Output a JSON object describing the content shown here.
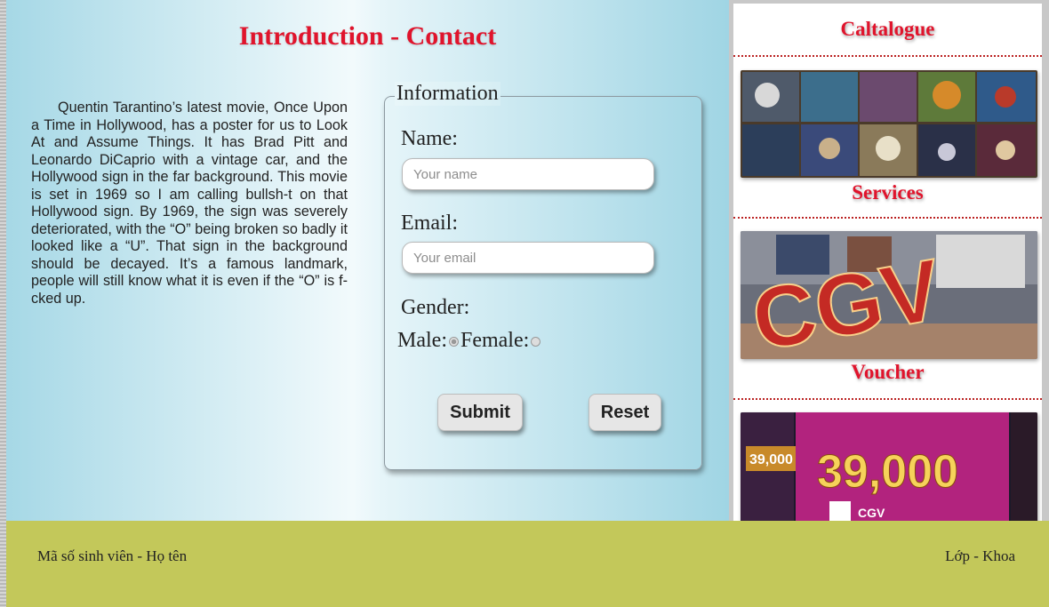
{
  "main": {
    "title": "Introduction - Contact",
    "intro_text": "Quentin Tarantino’s latest movie, Once Upon a Time in Hollywood, has a poster for us to Look At and Assume Things. It has Brad Pitt and Leonardo DiCaprio with a vintage car, and the Hollywood sign in the far background. This movie is set in 1969 so I am calling bullsh-t on that Hollywood sign. By 1969, the sign was severely deteriorated, with the “O” being broken so badly it looked like a “U”. That sign in the background should be decayed. It’s a famous landmark, people will still know what it is even if the “O” is f-cked up."
  },
  "form": {
    "legend": "Information",
    "name_label": "Name:",
    "name_placeholder": "Your name",
    "email_label": "Email:",
    "email_placeholder": "Your email",
    "gender_label": "Gender:",
    "male_label": "Male:",
    "female_label": "Female:",
    "submit_label": "Submit",
    "reset_label": "Reset"
  },
  "sidebar": {
    "catalogue_title": "Caltalogue",
    "services_title": "Services",
    "voucher_title": "Voucher",
    "cgv_sign_text": "CGV",
    "voucher_price_small": "39,000",
    "voucher_price_big": "39,000",
    "voucher_brand": "CGV"
  },
  "footer": {
    "left_text": "Mã số sinh viên - Họ tên",
    "right_text": "Lớp - Khoa"
  },
  "colors": {
    "title_red": "#e0142c",
    "footer_bg": "#c3c85a",
    "main_gradient_edge": "#a6d8e6"
  }
}
